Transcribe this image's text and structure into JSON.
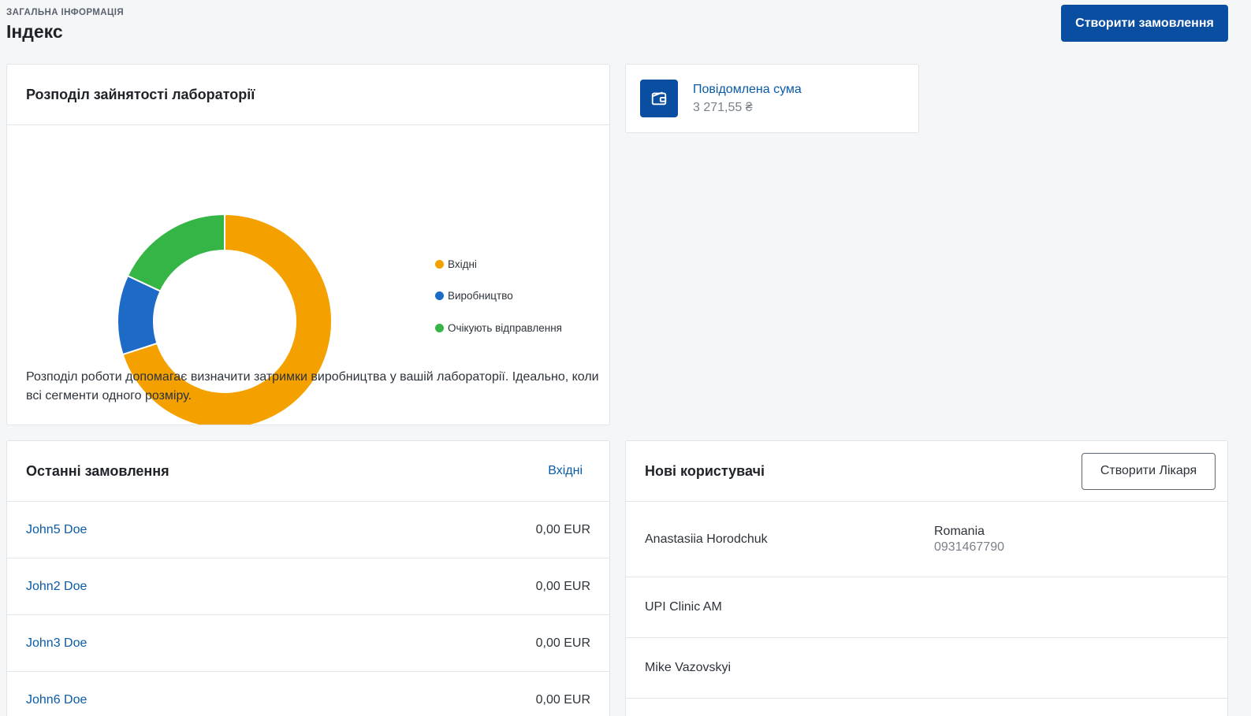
{
  "header": {
    "eyebrow": "ЗАГАЛЬНА ІНФОРМАЦІЯ",
    "title": "Індекс",
    "create_order_label": "Створити замовлення"
  },
  "workload": {
    "title": "Розподіл зайнятості лабораторії",
    "description": "Розподіл роботи допомагає визначити затримки виробництва у вашій лабораторії. Ідеально, коли всі сегменти одного розміру."
  },
  "chart_data": {
    "type": "pie",
    "donut": true,
    "categories": [
      "Вхідні",
      "Виробництво",
      "Очікують відправлення"
    ],
    "values": [
      70,
      12,
      18
    ],
    "colors": [
      "#f4a100",
      "#1e6ac7",
      "#34b545"
    ],
    "legend_position": "right"
  },
  "stat": {
    "icon": "wallet-icon",
    "label": "Повідомлена сума",
    "value": "3 271,55 ₴"
  },
  "orders": {
    "title": "Останні замовлення",
    "link_label": "Вхідні",
    "rows": [
      {
        "name": "John5 Doe",
        "amount": "0,00 EUR"
      },
      {
        "name": "John2 Doe",
        "amount": "0,00 EUR"
      },
      {
        "name": "John3 Doe",
        "amount": "0,00 EUR"
      },
      {
        "name": "John6 Doe",
        "amount": "0,00 EUR"
      }
    ]
  },
  "users": {
    "title": "Нові користувачі",
    "create_doctor_label": "Створити Лікаря",
    "rows": [
      {
        "name": "Anastasiia Horodchuk",
        "country": "Romania",
        "phone": "0931467790"
      },
      {
        "name": "UPI Clinic AM"
      },
      {
        "name": "Mike Vazovskyi"
      }
    ]
  },
  "colors": {
    "accent": "#0a4ea1",
    "link": "#0a5aa8",
    "background": "#f5f6f8"
  }
}
